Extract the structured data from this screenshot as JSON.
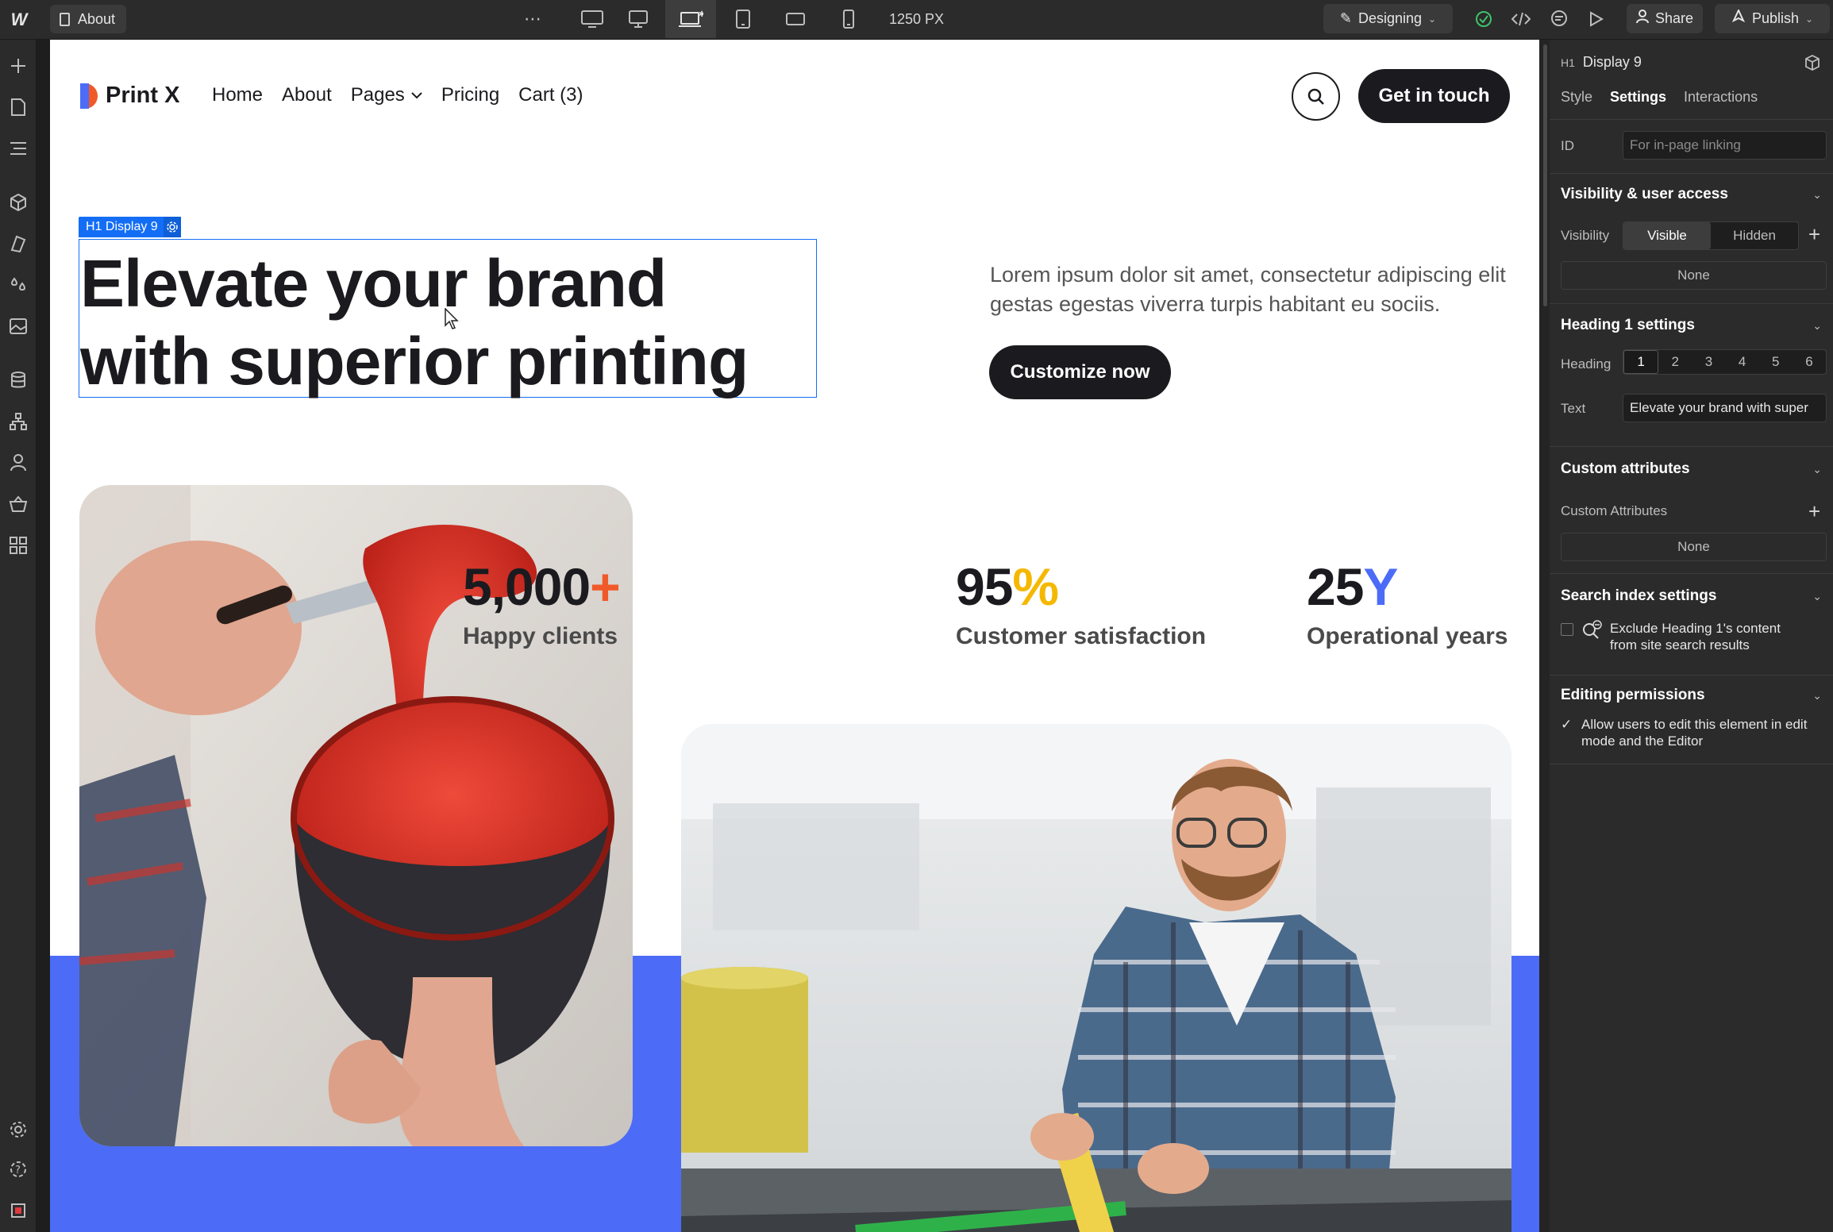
{
  "topbar": {
    "page_name": "About",
    "more": "⋯",
    "canvas_width": "1250 PX",
    "mode": "Designing",
    "share": "Share",
    "publish": "Publish"
  },
  "site": {
    "brand": "Print X",
    "nav": [
      "Home",
      "About",
      "Pages",
      "Pricing",
      "Cart (3)"
    ],
    "cta": "Get in touch",
    "selection_tag": "H1  Display 9",
    "hero_title_line1": "Elevate your brand",
    "hero_title_line2": "with superior printing",
    "hero_copy": "Lorem ipsum dolor sit amet, consectetur adipiscing elit gestas egestas viverra turpis habitant eu sociis.",
    "hero_cta": "Customize now",
    "stats": [
      {
        "value": "5,000",
        "suffix": "+",
        "suffix_color": "#f05a28",
        "label": "Happy clients"
      },
      {
        "value": "95",
        "suffix": "%",
        "suffix_color": "#f5b800",
        "label": "Customer satisfaction"
      },
      {
        "value": "25",
        "suffix": "Y",
        "suffix_color": "#4c6cf7",
        "label": "Operational years"
      }
    ],
    "accent_blue": "#4c6cf7"
  },
  "panel": {
    "tag": "H1",
    "element_name": "Display 9",
    "tabs": [
      "Style",
      "Settings",
      "Interactions"
    ],
    "id_label": "ID",
    "id_placeholder": "For in-page linking",
    "visibility_title": "Visibility & user access",
    "visibility_label": "Visibility",
    "visibility_options": [
      "Visible",
      "Hidden"
    ],
    "visibility_none": "None",
    "heading_title": "Heading 1 settings",
    "heading_label": "Heading",
    "heading_levels": [
      "1",
      "2",
      "3",
      "4",
      "5",
      "6"
    ],
    "text_label": "Text",
    "text_value": "Elevate your brand with super",
    "custom_title": "Custom attributes",
    "custom_label": "Custom Attributes",
    "custom_none": "None",
    "search_title": "Search index settings",
    "search_option": "Exclude Heading 1's content from site search results",
    "editing_title": "Editing permissions",
    "editing_option": "Allow users to edit this element in edit mode and the Editor"
  }
}
